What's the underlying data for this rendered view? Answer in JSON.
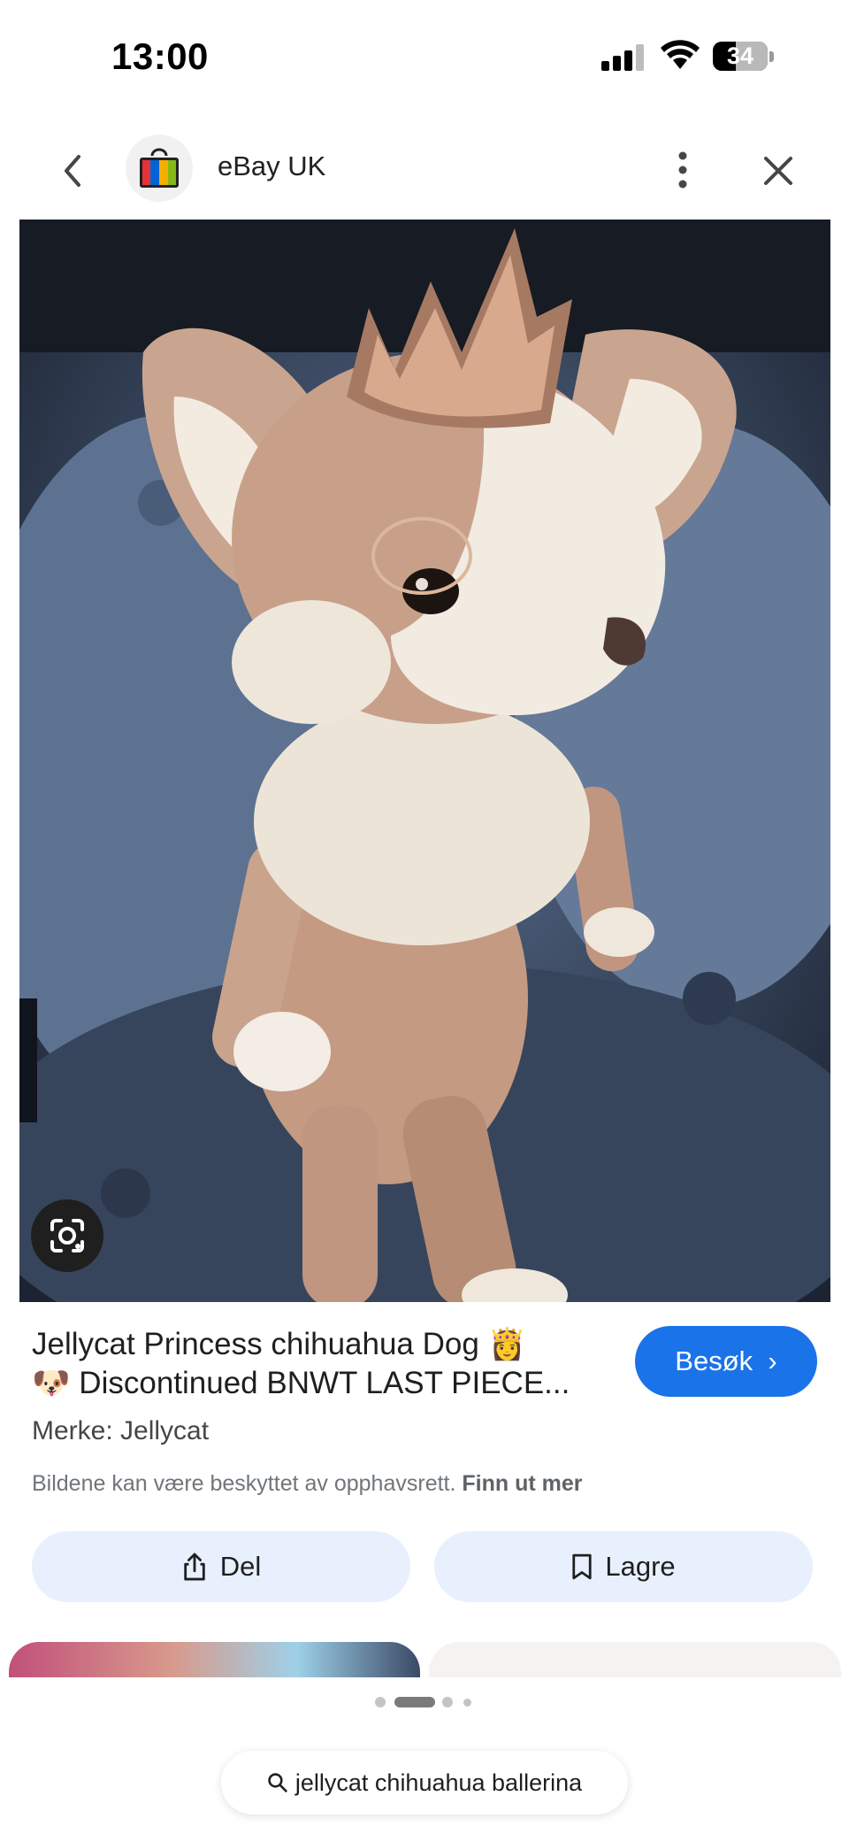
{
  "status_bar": {
    "time": "13:00",
    "battery": "34"
  },
  "header": {
    "site_name": "eBay UK"
  },
  "product": {
    "title_line1": "Jellycat Princess chihuahua Dog 👸",
    "title_line2": "🐶 Discontinued BNWT LAST PIECE...",
    "visit_label": "Besøk",
    "brand": "Merke: Jellycat",
    "copyright_text": "Bildene kan være beskyttet av opphavsrett.",
    "copyright_link": "Finn ut mer"
  },
  "actions": {
    "share_label": "Del",
    "save_label": "Lagre"
  },
  "pager": {
    "count": 4,
    "active_index": 1
  },
  "search": {
    "query": "jellycat chihuahua ballerina"
  },
  "colors": {
    "accent": "#1a73e8",
    "pill": "#e8f0fe"
  }
}
